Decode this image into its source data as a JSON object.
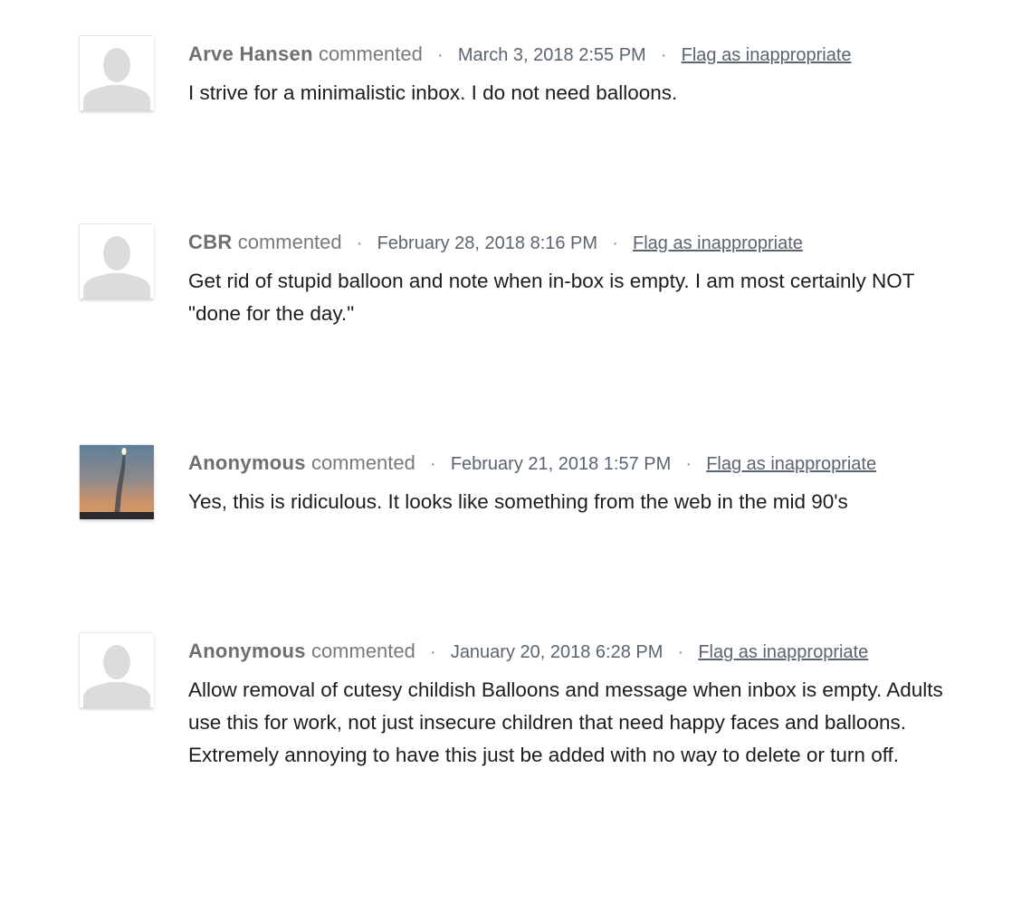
{
  "comments": [
    {
      "author": "Arve Hansen",
      "verb": "commented",
      "separator": "·",
      "date": "March 3, 2018 2:55 PM",
      "flag": "Flag as inappropriate",
      "text": "I strive for a minimalistic inbox. I do not need balloons.",
      "avatar": "default-person-icon"
    },
    {
      "author": "CBR",
      "verb": "commented",
      "separator": "·",
      "date": "February 28, 2018 8:16 PM",
      "flag": "Flag as inappropriate",
      "text": "Get rid of stupid balloon and note when in-box is empty. I am most certainly NOT \"done for the day.\"",
      "avatar": "default-person-icon"
    },
    {
      "author": "Anonymous",
      "verb": "commented",
      "separator": "·",
      "date": "February 21, 2018 1:57 PM",
      "flag": "Flag as inappropriate",
      "text": "Yes, this is ridiculous. It looks like something from the web in the mid 90's",
      "avatar": "rocket-launch-photo"
    },
    {
      "author": "Anonymous",
      "verb": "commented",
      "separator": "·",
      "date": "January 20, 2018 6:28 PM",
      "flag": "Flag as inappropriate",
      "text": "Allow removal of cutesy childish Balloons and message when inbox is empty. Adults use this for work, not just insecure children that need happy faces and balloons. Extremely annoying to have this just be added with no way to delete or turn off.",
      "avatar": "default-person-icon"
    }
  ]
}
